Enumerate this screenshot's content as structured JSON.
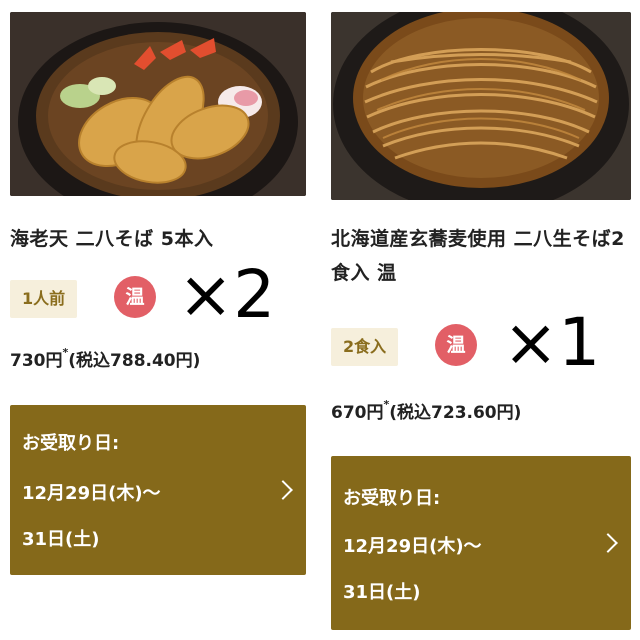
{
  "products": [
    {
      "title": "海老天 二八そば 5本入",
      "qty_tag": "1人前",
      "temp_badge": "温",
      "multiplier": "×2",
      "price_main": "730円",
      "price_mark": "*",
      "price_tax": "(税込788.40円)",
      "pickup": {
        "label": "お受取り日:",
        "dates_line1": "12月29日(木)〜",
        "dates_line2": "31日(土)"
      },
      "icons": {
        "photo": "tempura-soba-photo-icon",
        "chevron": "chevron-right-icon"
      }
    },
    {
      "title": "北海道産玄蕎麦使用 二八生そば2食入 温",
      "qty_tag": "2食入",
      "temp_badge": "温",
      "multiplier": "×1",
      "price_main": "670円",
      "price_mark": "*",
      "price_tax": "(税込723.60円)",
      "pickup": {
        "label": "お受取り日:",
        "dates_line1": "12月29日(木)〜",
        "dates_line2": "31日(土)"
      },
      "icons": {
        "photo": "soba-noodles-photo-icon",
        "chevron": "chevron-right-icon"
      }
    }
  ],
  "colors": {
    "pickup_bg": "#85691a",
    "tag_bg": "#f6efdc",
    "tag_text": "#8a6d1d",
    "badge_red": "#e25f66"
  }
}
